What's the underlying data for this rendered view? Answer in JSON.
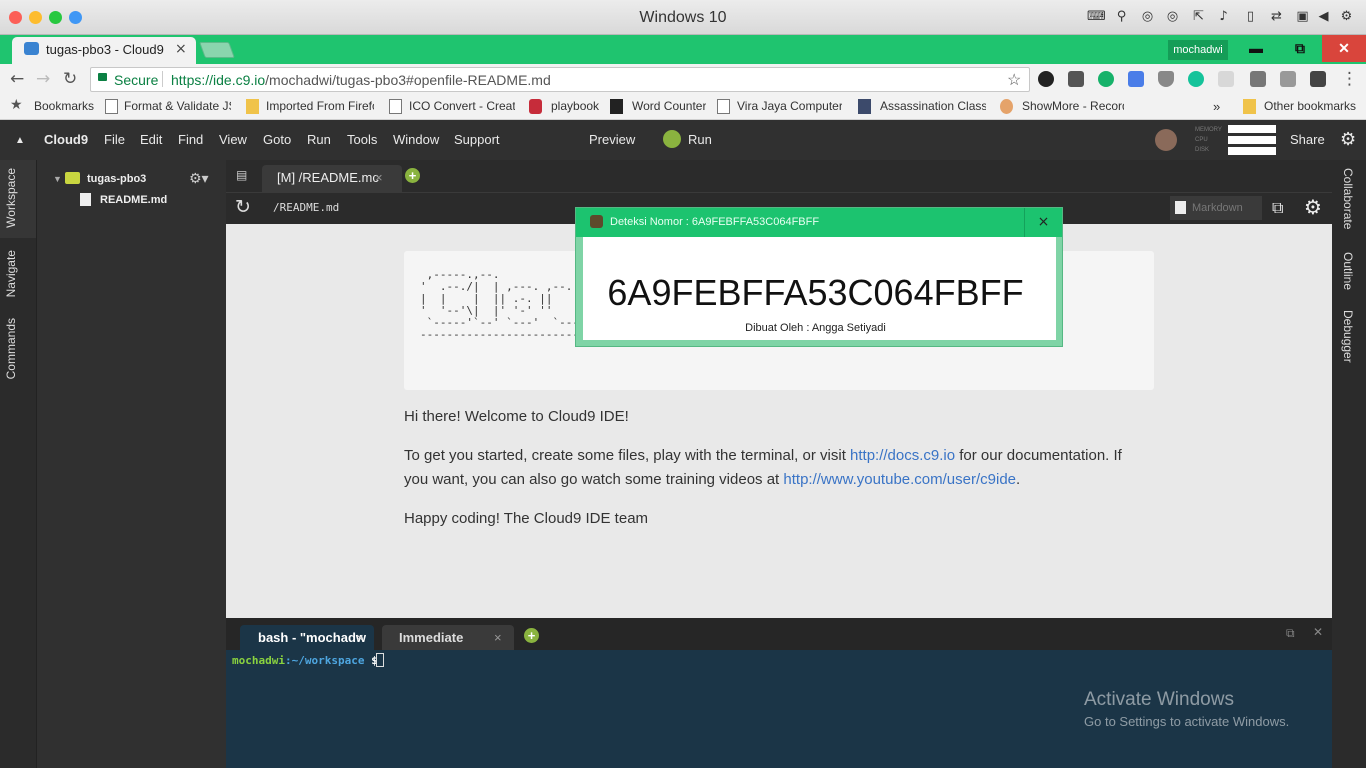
{
  "mac": {
    "title": "Windows 10",
    "colors": {
      "close": "#fc5f57",
      "min": "#fdbc2e",
      "max": "#28c840",
      "extra": "#3f97f5"
    }
  },
  "browser": {
    "tab_title": "tugas-pbo3 - Cloud9",
    "tab_close": "×",
    "user": "mochadwi",
    "window_buttons": {
      "minimize": "▬",
      "restore": "⧉",
      "close": "✕"
    },
    "secure_label": "Secure",
    "url_host": "https://ide.c9.io",
    "url_path": "/mochadwi/tugas-pbo3#openfile-README.md"
  },
  "bookmarks": {
    "items": [
      "Bookmarks",
      "Format & Validate JS",
      "Imported From Firefo",
      "ICO Convert - Create",
      "playbook",
      "Word Counter",
      "Vira Jaya Computer (",
      "Assassination Classro",
      "ShowMore - Record,"
    ],
    "more": "»",
    "other": "Other bookmarks"
  },
  "ide": {
    "menu": [
      "Cloud9",
      "File",
      "Edit",
      "Find",
      "View",
      "Goto",
      "Run",
      "Tools",
      "Window",
      "Support"
    ],
    "preview": "Preview",
    "run": "Run",
    "meters": [
      "MEMORY",
      "CPU",
      "DISK"
    ],
    "share": "Share",
    "left_tabs": [
      "Workspace",
      "Navigate",
      "Commands"
    ],
    "right_tabs": [
      "Collaborate",
      "Outline",
      "Debugger"
    ],
    "tree": {
      "folder": "tugas-pbo3",
      "file": "README.md"
    },
    "editor_tab": "[M] /README.mc",
    "editor_tab_close": "×",
    "path": "/README.md",
    "mode": "Markdown"
  },
  "readme": {
    "ascii": " ,-----.,--.\n'  .--./|  | ,---. ,--.\n|  |    |  || .-. ||\n'  '--'\\|  |' '-' ''\n `-----'`--' `---'  `---'  `---'  `-'   `-' `-------'  `------'\n-------------------------------------------------------------",
    "welcome": "Hi there! Welcome to Cloud9 IDE!",
    "p2_a": "To get you started, create some files, play with the terminal, or visit ",
    "p2_link1": "http://docs.c9.io",
    "p2_b": " for our documentation. If you want, you can also go watch some training videos at ",
    "p2_link2": "http://www.youtube.com/user/c9ide",
    "p2_c": ".",
    "closing": "Happy coding! The Cloud9 IDE team"
  },
  "terminal": {
    "tabs": [
      "bash - \"mochadw",
      "Immediate"
    ],
    "tab_close": "×",
    "user": "mochadwi",
    "path": ":~/workspace",
    "prompt": " $"
  },
  "popup": {
    "title": "Deteksi Nomor : 6A9FEBFFA53C064FBFF",
    "number": "6A9FEBFFA53C064FBFF",
    "byline": "Dibuat Oleh : Angga Setiyadi",
    "close": "×"
  },
  "activate": {
    "title": "Activate Windows",
    "subtitle": "Go to Settings to activate Windows."
  }
}
